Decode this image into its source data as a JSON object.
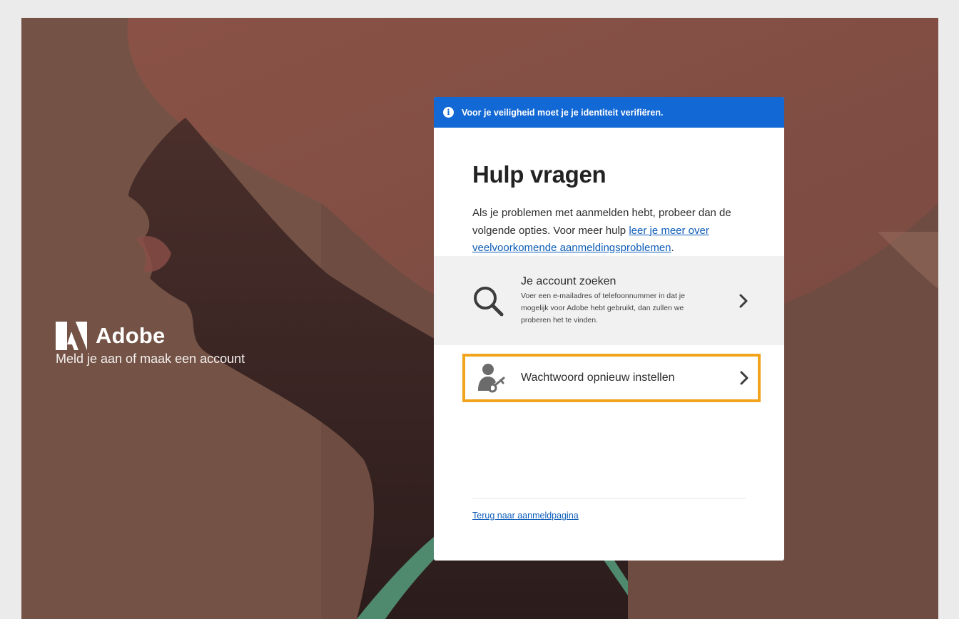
{
  "brand": {
    "name": "Adobe",
    "tagline": "Meld je aan of maak een account"
  },
  "banner": {
    "icon": "info-icon",
    "text": "Voor je veiligheid moet je je identiteit verifiëren."
  },
  "card": {
    "title": "Hulp vragen",
    "intro_text": "Als je problemen met aanmelden hebt, probeer dan de volgende opties. Voor meer hulp ",
    "intro_link": "leer je meer over veelvoorkomende aanmeldingsproblemen",
    "intro_end": "."
  },
  "options": [
    {
      "icon": "search-icon",
      "title": "Je account zoeken",
      "description": "Voer een e-mailadres of telefoonnummer in dat je mogelijk voor Adobe hebt gebruikt, dan zullen we proberen het te vinden."
    },
    {
      "icon": "user-key-icon",
      "title": "Wachtwoord opnieuw instellen"
    }
  ],
  "footer": {
    "back_link": "Terug naar aanmeldpagina"
  },
  "colors": {
    "banner": "#1268d4",
    "highlight": "#f0a31b",
    "link": "#0e5db8"
  }
}
